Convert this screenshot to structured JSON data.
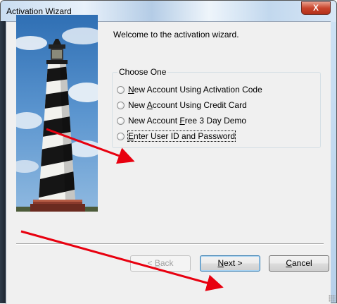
{
  "window": {
    "title": "Activation Wizard",
    "close_label": "X"
  },
  "welcome": {
    "text": "Welcome to the activation wizard."
  },
  "choice_group": {
    "label": "Choose One",
    "options": [
      {
        "pre": "",
        "accel": "N",
        "post": "ew Account Using Activation Code",
        "selected": false
      },
      {
        "pre": "New ",
        "accel": "A",
        "post": "ccount Using Credit Card",
        "selected": false
      },
      {
        "pre": "New Account ",
        "accel": "F",
        "post": "ree 3 Day Demo",
        "selected": false
      },
      {
        "pre": "",
        "accel": "E",
        "post": "nter User ID and Password",
        "selected": false,
        "focused": true
      }
    ]
  },
  "buttons": {
    "back": {
      "pre": "< ",
      "accel": "B",
      "post": "ack",
      "enabled": false
    },
    "next": {
      "pre": "",
      "accel": "N",
      "post": "ext >",
      "enabled": true,
      "default": true
    },
    "cancel": {
      "pre": "",
      "accel": "C",
      "post": "ancel",
      "enabled": true
    }
  },
  "annotations": {
    "arrow_color": "#e8000f"
  },
  "icons": {
    "close": "close-icon",
    "radio": "radio-icon",
    "resize": "resize-grip-icon",
    "image": "lighthouse-image"
  }
}
